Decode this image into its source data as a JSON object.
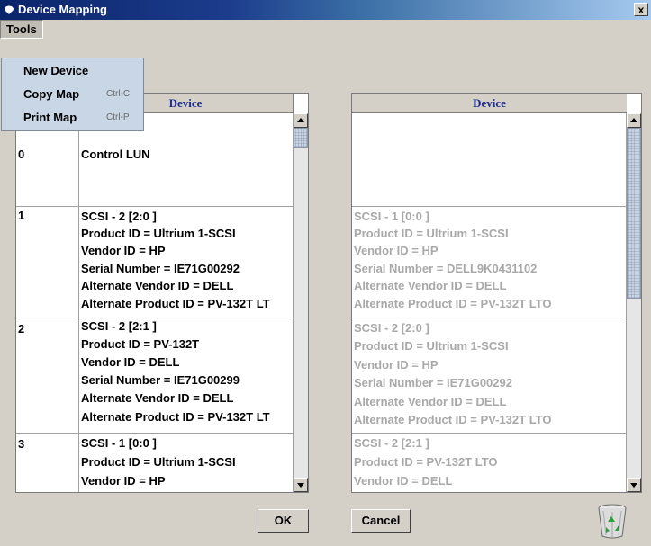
{
  "window": {
    "title": "Device Mapping",
    "close_label": "x"
  },
  "menubar": {
    "tools": "Tools"
  },
  "tools_menu": {
    "items": [
      {
        "label": "New Device",
        "accel": ""
      },
      {
        "label": "Copy Map",
        "accel": "Ctrl-C"
      },
      {
        "label": "Print Map",
        "accel": "Ctrl-P"
      }
    ]
  },
  "left_panel": {
    "header": "Device",
    "rows": [
      {
        "lun": "0",
        "lines": [
          "Control LUN"
        ]
      },
      {
        "lun": "1",
        "lines": [
          "SCSI - 2 [2:0 ]",
          "Product ID = Ultrium 1-SCSI",
          "Vendor ID =  HP",
          "Serial Number = IE71G00292",
          "Alternate Vendor ID = DELL",
          "Alternate Product ID = PV-132T LT"
        ]
      },
      {
        "lun": "2",
        "lines": [
          "SCSI - 2 [2:1 ]",
          "Product ID = PV-132T",
          "Vendor ID =  DELL",
          "Serial Number = IE71G00299",
          "Alternate Vendor ID = DELL",
          "Alternate Product ID = PV-132T LT"
        ]
      },
      {
        "lun": "3",
        "lines": [
          "SCSI - 1 [0:0 ]",
          "Product ID = Ultrium 1-SCSI",
          "Vendor ID =  HP"
        ]
      }
    ]
  },
  "right_panel": {
    "header": "Device",
    "rows": [
      {
        "lines": []
      },
      {
        "lines": [
          "SCSI - 1 [0:0 ]",
          "Product ID = Ultrium 1-SCSI",
          "Vendor ID =  HP",
          "Serial Number = DELL9K0431102",
          "Alternate Vendor ID = DELL",
          "Alternate Product ID = PV-132T  LTO"
        ]
      },
      {
        "lines": [
          "SCSI - 2 [2:0 ]",
          "Product ID = Ultrium 1-SCSI",
          "Vendor ID =  HP",
          "Serial Number = IE71G00292",
          "Alternate Vendor ID = DELL",
          "Alternate Product ID = PV-132T  LTO"
        ]
      },
      {
        "lines": [
          "SCSI - 2 [2:1 ]",
          "Product ID = PV-132T  LTO",
          "Vendor ID =  DELL"
        ]
      }
    ]
  },
  "buttons": {
    "ok": "OK",
    "cancel": "Cancel"
  },
  "icons": {
    "window": "device-icon",
    "trash": "recycle-bin-icon"
  },
  "colors": {
    "header_text": "#1c2c8c",
    "disabled_text": "#a9a9a9",
    "menu_bg": "#c9d6e6"
  }
}
